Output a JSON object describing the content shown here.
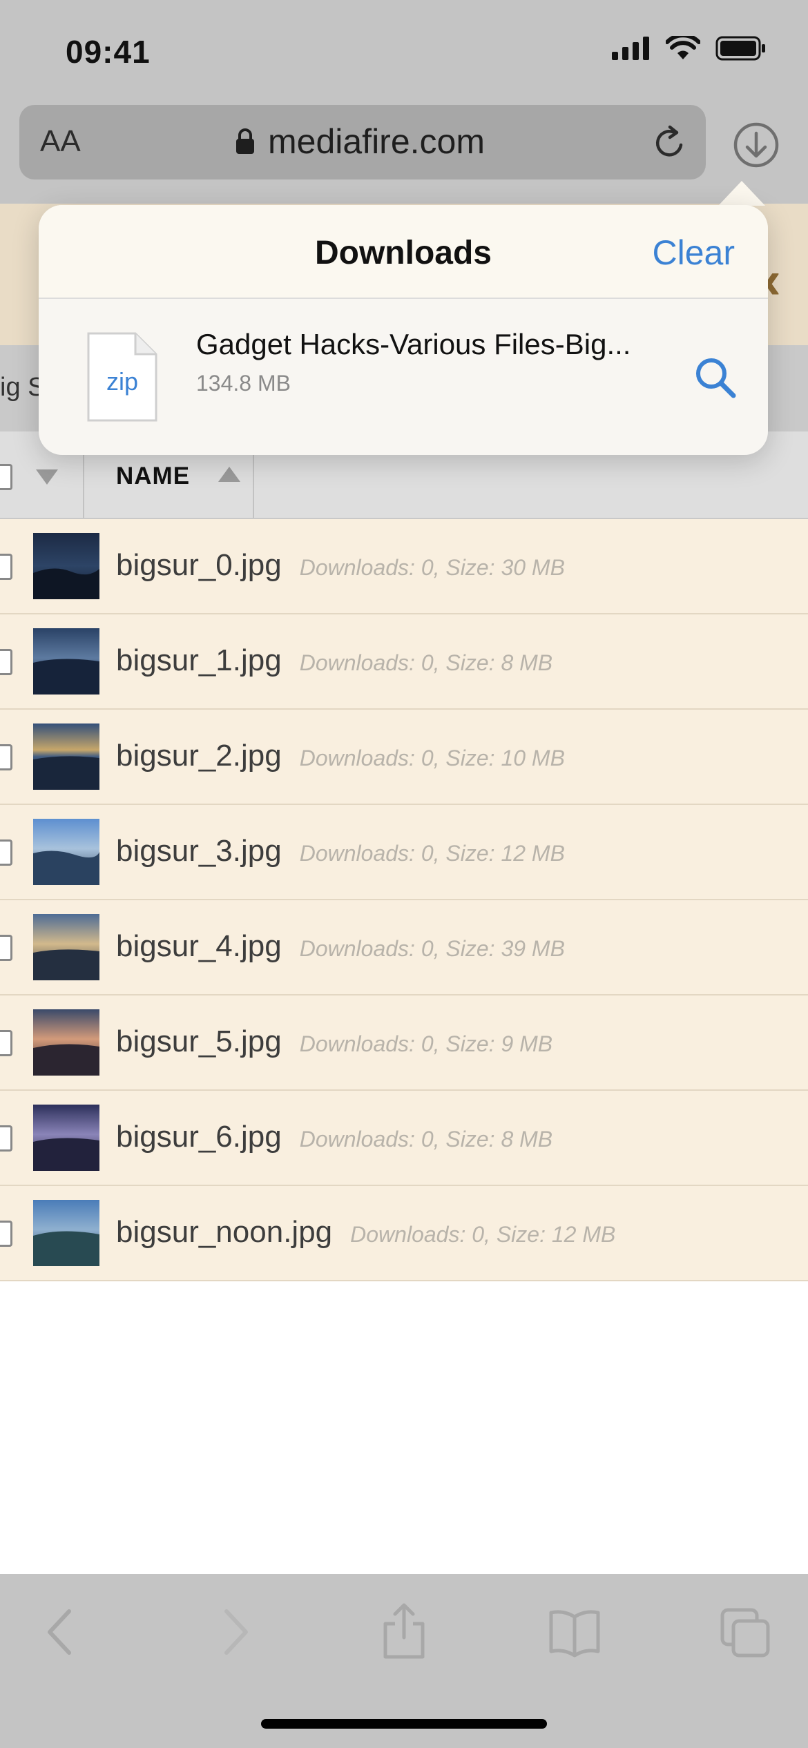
{
  "status_bar": {
    "time": "09:41"
  },
  "browser": {
    "text_size_label": "AA",
    "url": "mediafire.com"
  },
  "page": {
    "breadcrumb_fragment": "ig S",
    "column_header": {
      "name": "NAME"
    }
  },
  "downloads_popover": {
    "title": "Downloads",
    "clear_label": "Clear",
    "item": {
      "icon_label": "zip",
      "name": "Gadget Hacks-Various Files-Big...",
      "size": "134.8 MB"
    }
  },
  "files": [
    {
      "name": "bigsur_0.jpg",
      "meta": "Downloads: 0, Size: 30 MB"
    },
    {
      "name": "bigsur_1.jpg",
      "meta": "Downloads: 0, Size: 8 MB"
    },
    {
      "name": "bigsur_2.jpg",
      "meta": "Downloads: 0, Size: 10 MB"
    },
    {
      "name": "bigsur_3.jpg",
      "meta": "Downloads: 0, Size: 12 MB"
    },
    {
      "name": "bigsur_4.jpg",
      "meta": "Downloads: 0, Size: 39 MB"
    },
    {
      "name": "bigsur_5.jpg",
      "meta": "Downloads: 0, Size: 9 MB"
    },
    {
      "name": "bigsur_6.jpg",
      "meta": "Downloads: 0, Size: 8 MB"
    },
    {
      "name": "bigsur_noon.jpg",
      "meta": "Downloads: 0, Size: 12 MB"
    }
  ],
  "colors": {
    "accent": "#3b82d4",
    "row_background": "#f9efdf",
    "chrome": "#c4c4c4"
  },
  "toolbar_icons": [
    "back-icon",
    "forward-icon",
    "share-icon",
    "bookmarks-icon",
    "tabs-icon"
  ]
}
